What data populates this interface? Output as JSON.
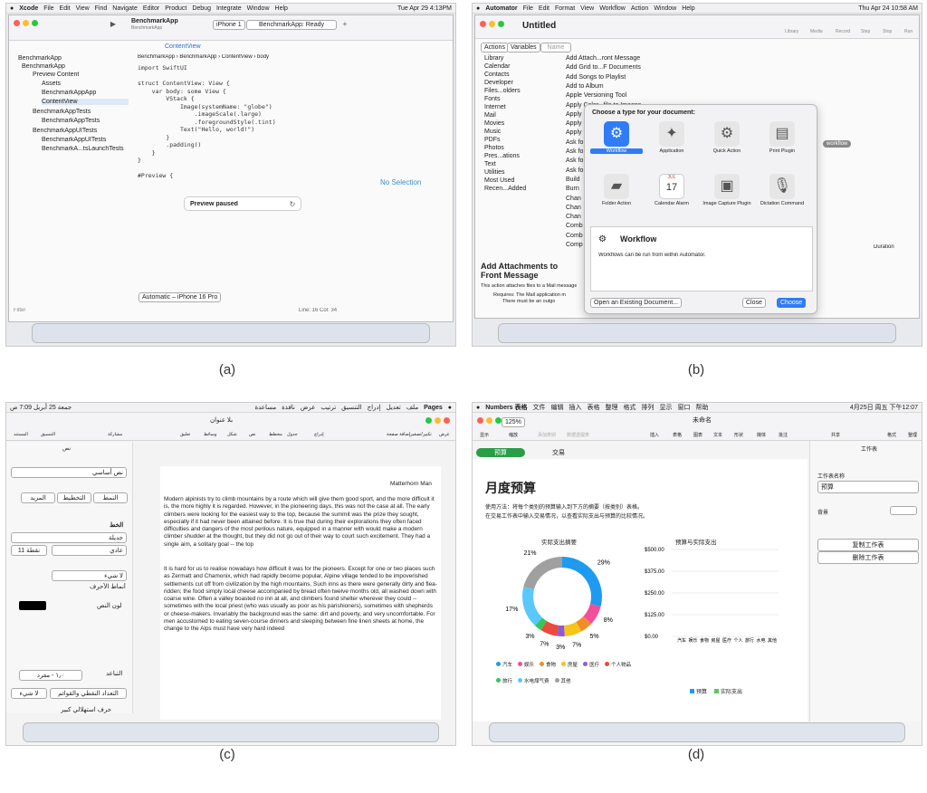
{
  "captions": [
    "(a)",
    "(b)",
    "(c)",
    "(d)"
  ],
  "a": {
    "menu": [
      "Xcode",
      "File",
      "Edit",
      "View",
      "Find",
      "Navigate",
      "Editor",
      "Product",
      "Debug",
      "Integrate",
      "Window",
      "Help"
    ],
    "clock": "Tue Apr 29  4:13PM",
    "app_name": "BenchmarkApp",
    "app_sub": "BenchmarkApp",
    "device": "iPhone 1",
    "status": "BenchmarkApp: Ready",
    "file_tab": "ContentView",
    "breadcrumb": [
      "BenchmarkApp",
      "BenchmarkApp",
      "ContentView",
      "body"
    ],
    "nav_items": [
      "BenchmarkApp",
      "BenchmarkApp",
      "Preview Content",
      "Assets",
      "BenchmarkAppApp",
      "ContentView",
      "BenchmarkAppTests",
      "BenchmarkAppTests",
      "BenchmarkAppUITests",
      "BenchmarkAppUITests",
      "BenchmarkA...tsLaunchTests"
    ],
    "code_lines": [
      "import SwiftUI",
      "",
      "struct ContentView: View {",
      "    var body: some View {",
      "        VStack {",
      "            Image(systemName: \"globe\")",
      "                .imageScale(.large)",
      "                .foregroundStyle(.tint)",
      "            Text(\"Hello, world!\")",
      "        }",
      "        .padding()",
      "    }",
      "}",
      "",
      "#Preview {"
    ],
    "no_selection": "No Selection",
    "preview_paused": "Preview paused",
    "preview_device": "Automatic – iPhone 16 Pro",
    "filter": "Filter",
    "cursor": "Line: 16  Col: 34"
  },
  "b": {
    "menu": [
      "Automator",
      "File",
      "Edit",
      "Format",
      "View",
      "Workflow",
      "Action",
      "Window",
      "Help"
    ],
    "clock": "Thu Apr 24  10:58 AM",
    "title": "Untitled",
    "tabs": [
      "Actions",
      "Variables"
    ],
    "search_placeholder": "Name",
    "toolbar": [
      "Library",
      "Media",
      "Record",
      "Step",
      "Stop",
      "Run"
    ],
    "library": [
      "Library",
      "Calendar",
      "Contacts",
      "Developer",
      "Files...olders",
      "Fonts",
      "Internet",
      "Mail",
      "Movies",
      "Music",
      "PDFs",
      "Photos",
      "Pres...ations",
      "Text",
      "Utilities",
      "Most Used",
      "Recen...Added"
    ],
    "actions": [
      "Add Attach...ront Message",
      "Add Grid to...F Documents",
      "Add Songs to Playlist",
      "Add to Album",
      "Apple Versioning Tool",
      "Apply Color...file to Images",
      "Apply",
      "Apply",
      "Apply",
      "Ask fo",
      "Ask fo",
      "Ask fo",
      "Ask fo",
      "Build",
      "Burn",
      "Chan",
      "Chan",
      "Chan",
      "Comb",
      "Comb",
      "Comp"
    ],
    "sheet_title": "Choose a type for your document:",
    "types": [
      "Workflow",
      "Application",
      "Quick Action",
      "Print Plugin",
      "Folder Action",
      "Calendar Alarm",
      "Image Capture Plugin",
      "Dictation Command"
    ],
    "cal_month": "JUL",
    "cal_day": "17",
    "desc_title": "Workflow",
    "desc_text": "Workflows can be run from within Automator.",
    "open_existing": "Open an Existing Document...",
    "close": "Close",
    "choose": "Choose",
    "workflow_pill": "workflow",
    "duration": "Duration",
    "info_title": "Add Attachments to Front Message",
    "info_text": "This action attaches files to a Mail message",
    "requires": "Requires: The Mail application m",
    "requires2": "There must be an outgo"
  },
  "c": {
    "menu": [
      "Pages",
      "ملف",
      "تعديل",
      "إدراج",
      "التنسيق",
      "ترتيب",
      "عرض",
      "نافذة",
      "مساعدة"
    ],
    "clock": "جمعة 25 أبريل  7:09 ص",
    "doc_title": "بلا عنوان",
    "toolbar_right": [
      "عرض",
      "تكبير/تصغير",
      "إضافة صفحة"
    ],
    "toolbar_mid": [
      "إدراج",
      "جدول",
      "مخطط",
      "نص",
      "شكل",
      "وسائط",
      "تعليق"
    ],
    "toolbar_left": [
      "مشاركة",
      "التنسيق",
      "المستند"
    ],
    "panel_tab": "نص",
    "style": "نص أساسي",
    "segments": [
      "النمط",
      "التخطيط",
      "المزيد"
    ],
    "font_label": "الخط",
    "font": "جديلة",
    "typeface": "عادي",
    "size": "11 نقطة",
    "char_style": "لا شيء",
    "char_style_label": "أنماط الأحرف",
    "color_label": "لون النص",
    "spacing_label": "التباعد",
    "spacing": "١٫٠ - مفرد",
    "bullets": "التعداد النقطي والقوائم",
    "bullets_val": "لا شيء",
    "dropcap": "حرف استهلالي كبير",
    "page_title": "Matterhorn Man",
    "para1": "Modern alpinists try to climb mountains by a route which will give them good sport, and the more difficult it is, the more highly it is regarded. However, in the pioneering days, this was not the case at all. The early climbers were looking for the easiest way to the top, because the summit was the prize they sought, especially if it had never been attained before. It is true that during their explorations they often faced difficulties and dangers of the most perilous nature, equipped in a manner with would make a modern climber shudder at the thought, but they did not go out of their way to court such excitement. They had a single aim, a solitary goal -- the top",
    "para2": "It is hard for us to realise nowadays how difficult it was for the pioneers. Except for one or two places such as Zermatt and Chamonix, which had rapidly become popular, Alpine village tended to be impoverished settlements cut off from civilization by the high mountains. Such inns as there were generally dirty and flea-ridden; the food simply local cheese accompanied by bread often twelve months old, all washed down with coarse wine. Often a valley boasted no inn at all, and climbers found shelter wherever they could -- sometimes with the local priest (who was usually as poor as his parishioners), sometimes with shepherds or cheese-makers. Invariably the background was the same: dirt and poverty, and very uncomfortable. For men accustomed to eating seven-course dinners and sleeping between fine linen sheets at home, the change to the Alps must have very hard indeed"
  },
  "d": {
    "menu": [
      "Numbers 表格",
      "文件",
      "编辑",
      "插入",
      "表格",
      "整理",
      "格式",
      "排列",
      "显示",
      "窗口",
      "帮助"
    ],
    "clock": "4月25日 周五 下午12:07",
    "doc_title": "未命名",
    "zoom": "125%",
    "toolbar_left": [
      "显示",
      "缩放",
      "添加类别",
      "数据透视表"
    ],
    "toolbar_mid": [
      "插入",
      "表格",
      "图表",
      "文本",
      "形状",
      "媒体",
      "批注"
    ],
    "toolbar_right": [
      "共享",
      "格式",
      "整理"
    ],
    "sheet_tabs": [
      "预算",
      "交易"
    ],
    "title": "月度预算",
    "instructions": [
      "使用方法：将每个类别的预算输入到下方的摘要（按类别）表格。",
      "在交易工作表中输入交易情况，以查看实际支出与预算的比较情况。"
    ],
    "donut_title": "实际支出摘要",
    "bar_title": "预算与实际支出",
    "pct_labels": [
      "29%",
      "8%",
      "5%",
      "7%",
      "3%",
      "7%",
      "3%",
      "17%",
      "21%"
    ],
    "y_ticks": [
      "$500.00",
      "$375.00",
      "$250.00",
      "$125.00",
      "$0.00"
    ],
    "legend": [
      "汽车",
      "娱乐",
      "食物",
      "房屋",
      "医疗",
      "个人物品",
      "旅行",
      "水电煤气费",
      "其他"
    ],
    "categories": [
      "汽车",
      "娱乐",
      "食物",
      "房屋",
      "医疗",
      "个人物品",
      "旅行",
      "水电煤气费",
      "其他"
    ],
    "bar_legend": [
      "预算",
      "实际支出"
    ],
    "sidebar_header": "工作表",
    "sheet_name_label": "工作表名称",
    "sheet_name": "预算",
    "background_label": "背景",
    "dup_sheet": "复制工作表",
    "del_sheet": "删除工作表",
    "colors": {
      "blue": "#1e9bf0",
      "green": "#5ac85a"
    }
  },
  "chart_data": {
    "type": "pie",
    "title": "实际支出摘要",
    "categories": [
      "汽车",
      "娱乐",
      "食物",
      "房屋",
      "医疗",
      "个人物品",
      "旅行",
      "水电煤气费",
      "其他"
    ],
    "values": [
      29,
      8,
      5,
      7,
      3,
      7,
      3,
      17,
      21
    ]
  }
}
